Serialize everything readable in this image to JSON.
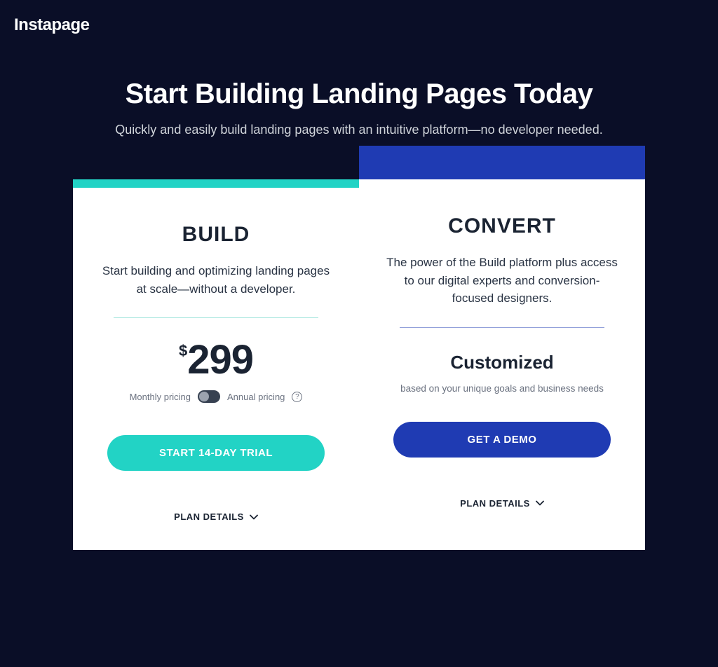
{
  "brand": {
    "name": "Instapage"
  },
  "hero": {
    "title": "Start Building Landing Pages Today",
    "subtitle": "Quickly and easily build landing pages with an intuitive platform—no developer needed."
  },
  "plans": {
    "build": {
      "name": "BUILD",
      "description": "Start building and optimizing landing pages at scale—without a developer.",
      "currency": "$",
      "price": "299",
      "toggle": {
        "monthly_label": "Monthly pricing",
        "annual_label": "Annual pricing"
      },
      "cta": "START 14-DAY TRIAL",
      "details_label": "PLAN DETAILS",
      "accent": "#22d3c5"
    },
    "convert": {
      "name": "CONVERT",
      "description": "The power of the Build platform plus access to our digital experts and conversion-focused designers.",
      "customized_title": "Customized",
      "customized_sub": "based on your unique goals and business needs",
      "cta": "GET A DEMO",
      "details_label": "PLAN DETAILS",
      "accent": "#1f3bb3"
    }
  }
}
